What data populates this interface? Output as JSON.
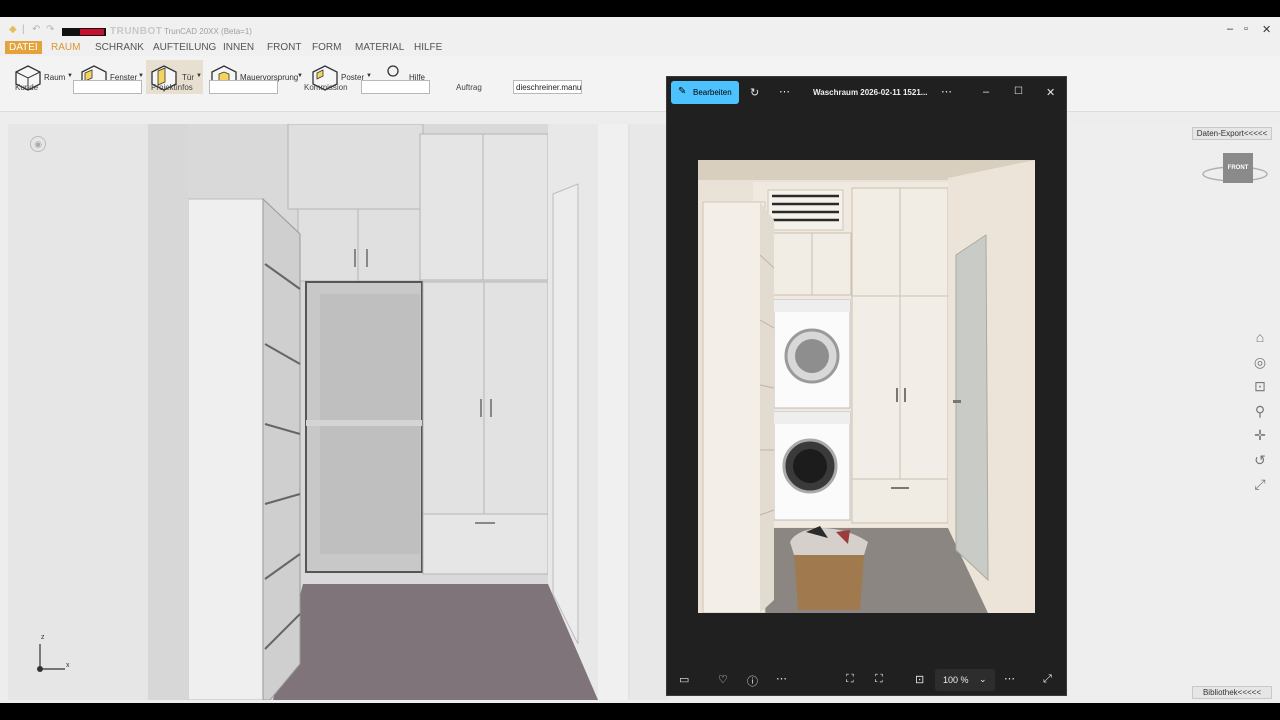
{
  "app": {
    "brand": "TRUNBOT",
    "title": "TrunCAD 20XX (Beta=1)",
    "window_controls": {
      "minimize": "–",
      "restore": "▫",
      "close": "✕"
    }
  },
  "menu": [
    "DATEI",
    "RAUM",
    "SCHRANK",
    "AUFTEILUNG",
    "INNEN",
    "FRONT",
    "FORM",
    "MATERIAL",
    "HILFE"
  ],
  "ribbon": {
    "buttons": [
      {
        "label": "Raum",
        "has_dropdown": true
      },
      {
        "label": "Fenster",
        "has_dropdown": true
      },
      {
        "label": "Tür",
        "has_dropdown": true,
        "selected": true
      },
      {
        "label": "Mauervorsprung",
        "has_dropdown": true
      },
      {
        "label": "Poster",
        "has_dropdown": true
      },
      {
        "label": "Hilfe",
        "has_dropdown": false
      }
    ],
    "fields": [
      {
        "label": "Kunde",
        "value": ""
      },
      {
        "label": "Projektinfos",
        "value": ""
      },
      {
        "label": "Kommission",
        "value": ""
      },
      {
        "label": "Auftrag",
        "value": "dieschreiner.manuf"
      }
    ]
  },
  "side_tabs": {
    "top": "Daten-Export<<<<<",
    "bottom": "Bibliothek<<<<<"
  },
  "view_cube": {
    "label": "FRONT"
  },
  "nav_icons": [
    "home-icon",
    "orbit-icon",
    "zoom-window-icon",
    "zoom-icon",
    "pan-icon",
    "rotate-icon",
    "fit-icon"
  ],
  "axis": {
    "z": "z",
    "x": "x"
  },
  "photos": {
    "edit_label": "Bearbeiten",
    "file_title": "Waschraum 2026-02-11 1521...",
    "zoom_value": "100 %"
  }
}
